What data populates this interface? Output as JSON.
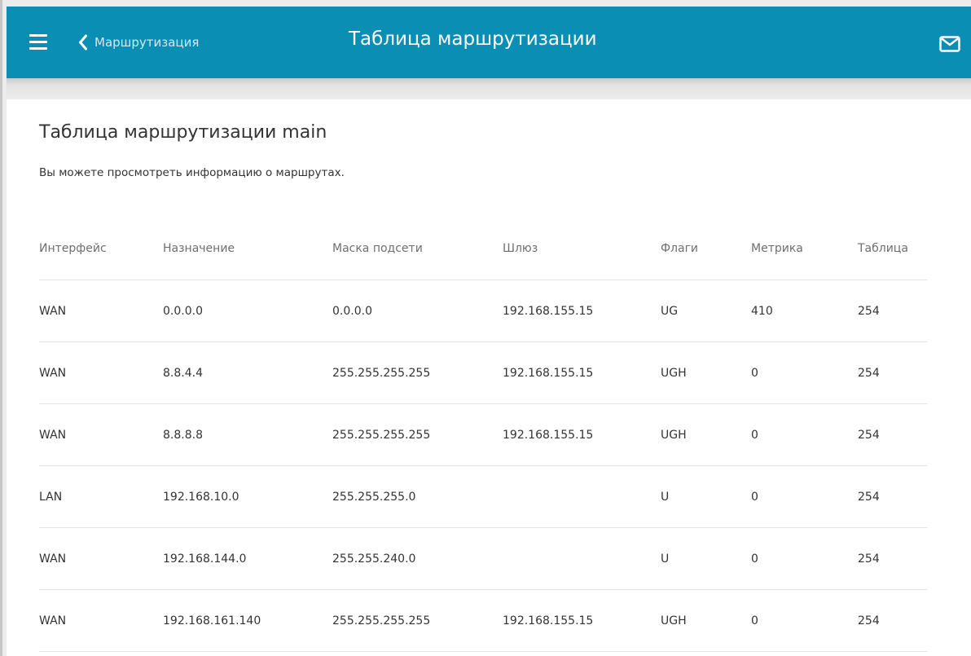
{
  "header": {
    "back_label": "Маршрутизация",
    "title": "Таблица маршрутизации"
  },
  "section": {
    "title": "Таблица маршрутизации main",
    "description": "Вы можете просмотреть информацию о маршрутах."
  },
  "table": {
    "columns": [
      "Интерфейс",
      "Назначение",
      "Маска подсети",
      "Шлюз",
      "Флаги",
      "Метрика",
      "Таблица"
    ],
    "rows": [
      [
        "WAN",
        "0.0.0.0",
        "0.0.0.0",
        "192.168.155.15",
        "UG",
        "410",
        "254"
      ],
      [
        "WAN",
        "8.8.4.4",
        "255.255.255.255",
        "192.168.155.15",
        "UGH",
        "0",
        "254"
      ],
      [
        "WAN",
        "8.8.8.8",
        "255.255.255.255",
        "192.168.155.15",
        "UGH",
        "0",
        "254"
      ],
      [
        "LAN",
        "192.168.10.0",
        "255.255.255.0",
        "",
        "U",
        "0",
        "254"
      ],
      [
        "WAN",
        "192.168.144.0",
        "255.255.240.0",
        "",
        "U",
        "0",
        "254"
      ],
      [
        "WAN",
        "192.168.161.140",
        "255.255.255.255",
        "192.168.155.15",
        "UGH",
        "0",
        "254"
      ]
    ]
  },
  "icons": {
    "menu": "hamburger-menu-icon",
    "back": "chevron-left-icon",
    "notifications": "mail-icon"
  },
  "colors": {
    "header_background": "#0a8eb3",
    "header_text": "#ffffff",
    "back_link_text": "#cfeaf3",
    "body_text": "#333333",
    "column_header_text": "#6f6f6f",
    "divider": "#e3e3e3",
    "page_background": "#ececec"
  }
}
